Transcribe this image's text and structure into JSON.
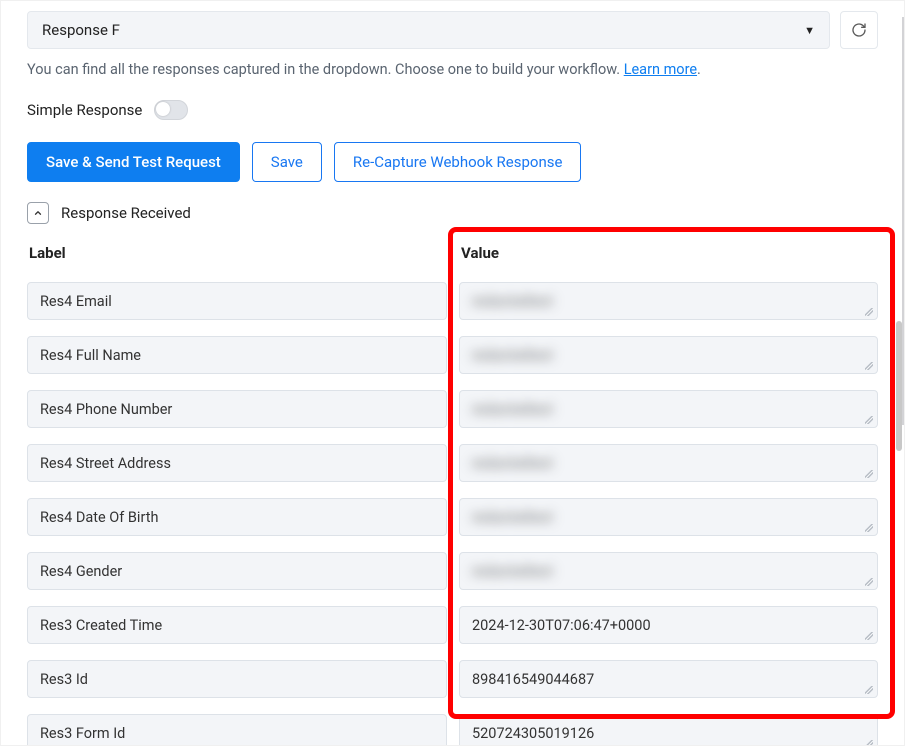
{
  "dropdown": {
    "selected": "Response F"
  },
  "helper": {
    "text_before_link": "You can find all the responses captured in the dropdown. Choose one to build your workflow. ",
    "link_text": "Learn more",
    "text_after_link": "."
  },
  "simple_response": {
    "label": "Simple Response",
    "on": false
  },
  "buttons": {
    "save_send": "Save & Send Test Request",
    "save": "Save",
    "recapture": "Re-Capture Webhook Response"
  },
  "received_label": "Response Received",
  "columns": {
    "label": "Label",
    "value": "Value"
  },
  "rows": [
    {
      "label": "Res4 Email",
      "value": "",
      "blurred": true
    },
    {
      "label": "Res4 Full Name",
      "value": "",
      "blurred": true
    },
    {
      "label": "Res4 Phone Number",
      "value": "",
      "blurred": true
    },
    {
      "label": "Res4 Street Address",
      "value": "",
      "blurred": true
    },
    {
      "label": "Res4 Date Of Birth",
      "value": "",
      "blurred": true
    },
    {
      "label": "Res4 Gender",
      "value": "",
      "blurred": true
    },
    {
      "label": "Res3 Created Time",
      "value": "2024-12-30T07:06:47+0000",
      "blurred": false
    },
    {
      "label": "Res3 Id",
      "value": "898416549044687",
      "blurred": false
    },
    {
      "label": "Res3 Form Id",
      "value": "520724305019126",
      "blurred": false
    }
  ],
  "annotation": {
    "value_column_highlighted": true
  }
}
